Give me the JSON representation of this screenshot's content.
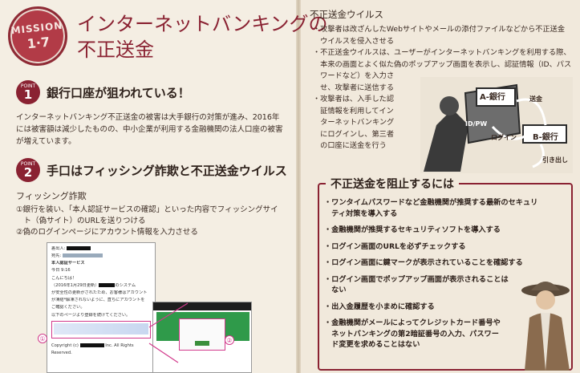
{
  "stamp": {
    "line1": "MISSION",
    "line2": "1·7"
  },
  "title": {
    "line1": "インターネットバンキングの",
    "line2": "不正送金"
  },
  "point1": {
    "badge_word": "POINT",
    "badge_num": "1",
    "heading": "銀行口座が狙われている！"
  },
  "point1_text": [
    "インターネットバンキング不正送金の被害は大手銀行の対策が進み、2016年",
    "には被害額は減少したものの、中小企業が利用する金融機関の法人口座の被害",
    "が増えています。"
  ],
  "point2": {
    "badge_word": "POINT",
    "badge_num": "2",
    "heading": "手口はフィッシング詐欺と不正送金ウイルス"
  },
  "phishing_label": "フィッシング詐欺",
  "steps": [
    "①銀行を装い、「本人認証サービスの確認」といった内容でフィッシングサイ",
    "　ト（偽サイト）のURLを送りつける",
    "②偽のログインページにアカウント情報を入力させる"
  ],
  "email": {
    "from_label": "差出人:",
    "to_label": "宛先:",
    "subject": "本人認証サービス",
    "date": "今日 9:16",
    "greeting": "こんにちは！",
    "body1": "（2016年1月29日更新）",
    "body2": "のシステム",
    "body3": "が安全性の更新がされたため、お客様はアカウント",
    "body4": "が凍結*解凍されないように、直ちにアカウントを",
    "body5": "ご確認ください。",
    "body6": "以下のページより登録を続けてください。",
    "copyright": "Copyright (c)",
    "inc": "Inc. All Rights",
    "reserved": "Reserved."
  },
  "markers": [
    "①",
    "②"
  ],
  "right_title": "不正送金ウイルス",
  "virus_bullets": [
    "・攻撃者は改ざんしたWebサイトやメールの添付ファイルなどから不正送金",
    "　ウイルスを侵入させる",
    "・不正送金ウイルスは、ユーザーがインターネットバンキングを利用する際、",
    "　本来の画面とよく似た偽のポップアップ画面を表示し、認証情報（ID、パス",
    "　ワードなど）を入力さ",
    "　せ、攻撃者に送信する",
    "・攻撃者は、入手した認",
    "　証情報を利用してイン",
    "　ターネットバンキング",
    "　にログインし、第三者",
    "　の口座に送金を行う"
  ],
  "illustration": {
    "bank_a": "A-銀行",
    "bank_b": "B-銀行",
    "remit": "送金",
    "idpw": "ID/PW",
    "login": "ログイン",
    "withdraw": "引き出し"
  },
  "prevent": {
    "title": "不正送金を阻止するには",
    "items": [
      [
        "・ワンタイムパスワードなど金融機関が推奨する最新のセキュリ",
        "　ティ対策を導入する"
      ],
      [
        "・金融機関が推奨するセキュリティソフトを導入する"
      ],
      [
        "・ログイン画面のURLを必ずチェックする"
      ],
      [
        "・ログイン画面に鍵マークが表示されていることを確認する"
      ],
      [
        "・ログイン画面でポップアップ画面が表示されることは",
        "　ない"
      ],
      [
        "・出入金履歴を小まめに確認する"
      ],
      [
        "・金融機関がメールによってクレジットカード番号や",
        "　ネットバンキングの第2暗証番号の入力、パスワー",
        "　ド変更を求めることはない"
      ]
    ]
  },
  "colors": {
    "accent": "#8a2232",
    "pink": "#d23a8c",
    "paper": "#f3ece0"
  }
}
